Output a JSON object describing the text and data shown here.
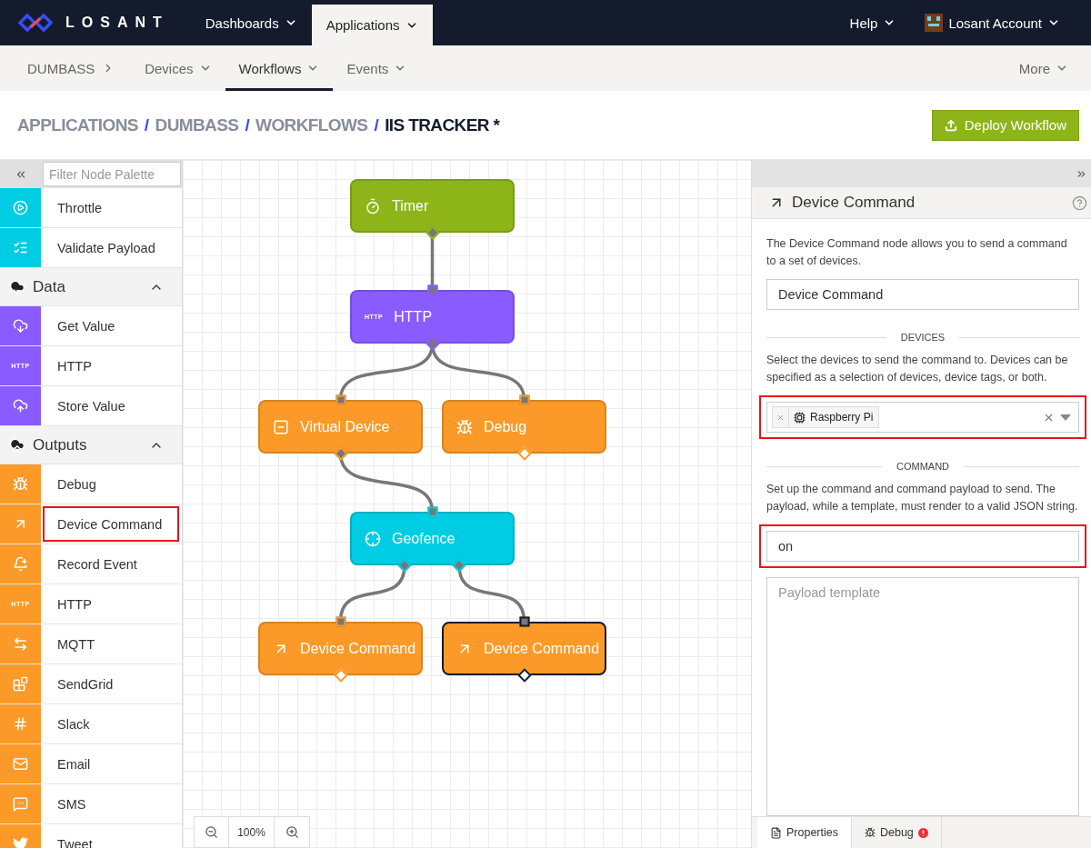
{
  "nav": {
    "logo": "LOSANT",
    "menus": [
      {
        "label": "Dashboards",
        "selected": false
      },
      {
        "label": "Applications",
        "selected": true
      }
    ],
    "help": "Help",
    "account": "Losant Account"
  },
  "subnav": {
    "app": "DUMBASS",
    "tabs": [
      {
        "label": "Devices",
        "selected": false
      },
      {
        "label": "Workflows",
        "selected": true
      },
      {
        "label": "Events",
        "selected": false
      }
    ],
    "more": "More"
  },
  "breadcrumb": {
    "items": [
      "APPLICATIONS",
      "DUMBASS",
      "WORKFLOWS",
      "IIS TRACKER *"
    ],
    "separator": "/"
  },
  "deploy_button": "Deploy Workflow",
  "palette": {
    "filter_placeholder": "Filter Node Palette",
    "groups": [
      {
        "color": "#00cde3",
        "items": [
          {
            "label": "Throttle",
            "kind": "throttle",
            "highlighted": false
          },
          {
            "label": "Validate Payload",
            "kind": "validate",
            "highlighted": false
          }
        ]
      },
      {
        "title": "Data",
        "expanded": true,
        "kind": "download",
        "color": "#8a5cff",
        "items": [
          {
            "label": "Get Value",
            "kind": "get",
            "highlighted": false
          },
          {
            "label": "HTTP",
            "kind": "http",
            "badge": "HTTP",
            "highlighted": false
          },
          {
            "label": "Store Value",
            "kind": "store",
            "highlighted": false
          }
        ]
      },
      {
        "title": "Outputs",
        "expanded": true,
        "kind": "upload",
        "color": "#fb9a28",
        "items": [
          {
            "label": "Debug",
            "kind": "debug",
            "highlighted": false
          },
          {
            "label": "Device Command",
            "kind": "command",
            "highlighted": true
          },
          {
            "label": "Record Event",
            "kind": "event",
            "highlighted": false
          },
          {
            "label": "HTTP",
            "kind": "http",
            "badge": "HTTP",
            "highlighted": false
          },
          {
            "label": "MQTT",
            "kind": "mqtt",
            "highlighted": false
          },
          {
            "label": "SendGrid",
            "kind": "sendgrid",
            "highlighted": false
          },
          {
            "label": "Slack",
            "kind": "slack",
            "highlighted": false
          },
          {
            "label": "Email",
            "kind": "email",
            "highlighted": false
          },
          {
            "label": "SMS",
            "kind": "sms",
            "highlighted": false
          },
          {
            "label": "Tweet",
            "kind": "tweet",
            "highlighted": false
          }
        ]
      }
    ]
  },
  "canvas": {
    "nodes": [
      {
        "label": "Timer",
        "kind": "timer",
        "color": "#8db51a",
        "selected": false
      },
      {
        "label": "HTTP",
        "kind": "http",
        "badge": "HTTP",
        "color": "#8a5cff",
        "selected": false
      },
      {
        "label": "Virtual Device",
        "kind": "device",
        "color": "#fb9a28",
        "selected": false
      },
      {
        "label": "Debug",
        "kind": "debug",
        "color": "#fb9a28",
        "selected": false
      },
      {
        "label": "Geofence",
        "kind": "geofence",
        "color": "#00cde3",
        "selected": false
      },
      {
        "label": "Device Command",
        "kind": "command",
        "color": "#fb9a28",
        "selected": false
      },
      {
        "label": "Device Command",
        "kind": "command",
        "color": "#fb9a28",
        "selected": true
      }
    ],
    "zoom": "100%"
  },
  "properties": {
    "title": "Device Command",
    "description": "The Device Command node allows you to send a command to a set of devices.",
    "name_value": "Device Command",
    "devices_heading": "DEVICES",
    "devices_help": "Select the devices to send the command to. Devices can be specified as a selection of devices, device tags, or both.",
    "devices_select": {
      "tags": [
        "Raspberry Pi"
      ],
      "highlighted": true
    },
    "command_heading": "COMMAND",
    "command_help": "Set up the command and command payload to send. The payload, while a template, must render to a valid JSON string.",
    "command_field": {
      "value": "on",
      "highlighted": true
    },
    "payload_placeholder": "Payload template",
    "tabs": [
      {
        "label": "Properties",
        "kind": "properties",
        "selected": true,
        "alert": false
      },
      {
        "label": "Debug",
        "kind": "debug",
        "selected": false,
        "alert": true
      }
    ]
  }
}
